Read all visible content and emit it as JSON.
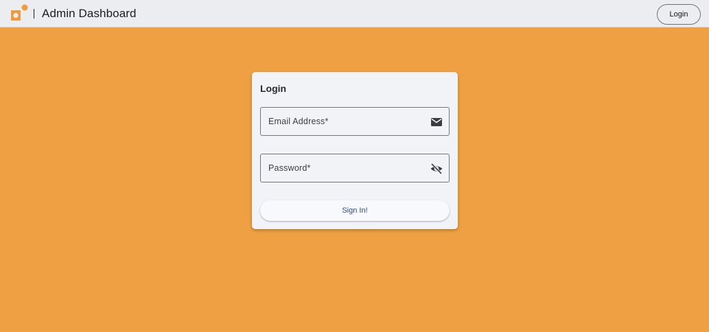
{
  "header": {
    "app_title": "Admin Dashboard",
    "login_button": "Login",
    "logo_icon": "brand-logo-icon"
  },
  "login_card": {
    "title": "Login",
    "email": {
      "label": "Email Address*",
      "value": "",
      "icon": "mail-icon"
    },
    "password": {
      "label": "Password*",
      "value": "",
      "icon": "visibility-off-icon"
    },
    "submit_label": "Sign In!"
  },
  "colors": {
    "background": "#EEA042",
    "topbar": "#ECEDF1",
    "card": "#F2F3F6",
    "accent": "#F09A3E",
    "button_text": "#2B4A7E"
  }
}
